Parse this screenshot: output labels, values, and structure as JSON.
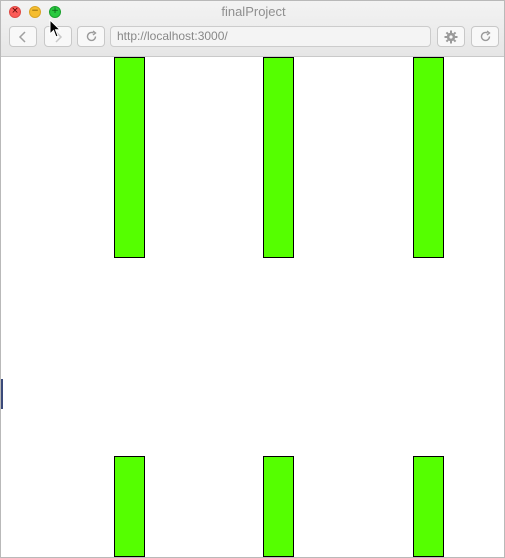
{
  "window": {
    "title": "finalProject"
  },
  "toolbar": {
    "back_icon": "chevron-left-icon",
    "forward_icon": "chevron-right-icon",
    "reload_icon": "reload-icon",
    "settings_icon": "gear-icon",
    "refresh_icon": "refresh-icon"
  },
  "address_bar": {
    "url": "http://localhost:3000/"
  },
  "canvas": {
    "bar_color": "#55ff00",
    "bar_border_color": "#000000",
    "rows": [
      {
        "name": "top-row",
        "count": 3
      },
      {
        "name": "bottom-row",
        "count": 3
      }
    ]
  },
  "colors": {
    "close": "#fc5b57",
    "minimize": "#f5bd2f",
    "maximize": "#29c940"
  }
}
